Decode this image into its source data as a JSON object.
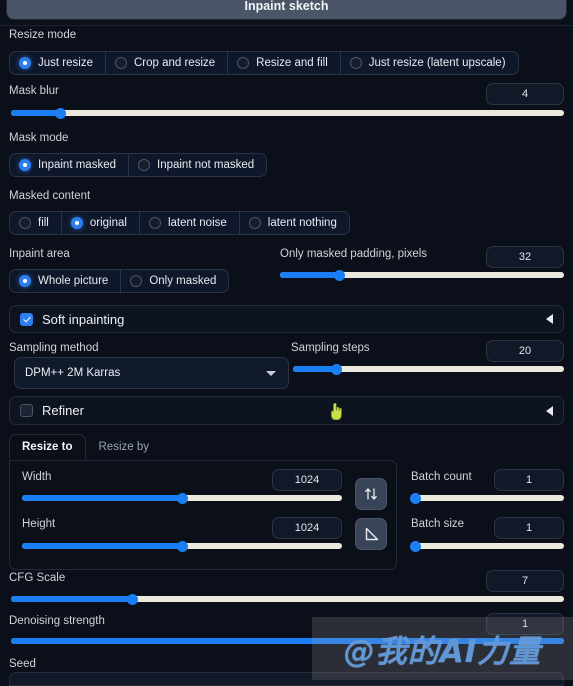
{
  "app": {
    "name": "stable-diffusion-webui-img2img-inpaint",
    "accent_color": "#2f7ef0",
    "slider_track_color": "#eceadf",
    "background_color": "#0b0f19"
  },
  "top_tab": {
    "label": "Inpaint sketch"
  },
  "resize_mode": {
    "label": "Resize mode",
    "options": [
      {
        "label": "Just resize",
        "selected": true
      },
      {
        "label": "Crop and resize",
        "selected": false
      },
      {
        "label": "Resize and fill",
        "selected": false
      },
      {
        "label": "Just resize (latent upscale)",
        "selected": false
      }
    ]
  },
  "mask_blur": {
    "label": "Mask blur",
    "value": "4",
    "percent": 9
  },
  "mask_mode": {
    "label": "Mask mode",
    "options": [
      {
        "label": "Inpaint masked",
        "selected": true
      },
      {
        "label": "Inpaint not masked",
        "selected": false
      }
    ]
  },
  "masked_content": {
    "label": "Masked content",
    "options": [
      {
        "label": "fill",
        "selected": false
      },
      {
        "label": "original",
        "selected": true
      },
      {
        "label": "latent noise",
        "selected": false
      },
      {
        "label": "latent nothing",
        "selected": false
      }
    ]
  },
  "inpaint_area": {
    "label": "Inpaint area",
    "options": [
      {
        "label": "Whole picture",
        "selected": true
      },
      {
        "label": "Only masked",
        "selected": false
      }
    ]
  },
  "only_masked_padding": {
    "label": "Only masked padding, pixels",
    "value": "32",
    "percent": 21
  },
  "soft_inpainting": {
    "label": "Soft inpainting",
    "checked": true,
    "expanded": false
  },
  "sampling_method": {
    "label": "Sampling method",
    "value": "DPM++ 2M Karras"
  },
  "sampling_steps": {
    "label": "Sampling steps",
    "value": "20",
    "percent": 16
  },
  "refiner": {
    "label": "Refiner",
    "checked": false,
    "expanded": false
  },
  "resize_panel": {
    "tabs": [
      {
        "label": "Resize to",
        "active": true
      },
      {
        "label": "Resize by",
        "active": false
      }
    ],
    "width": {
      "label": "Width",
      "value": "1024",
      "percent": 50
    },
    "height": {
      "label": "Height",
      "value": "1024",
      "percent": 50
    },
    "swap_icon": "swap-dimensions-icon",
    "ratio_icon": "aspect-ratio-icon"
  },
  "batch_count": {
    "label": "Batch count",
    "value": "1",
    "percent": 0
  },
  "batch_size": {
    "label": "Batch size",
    "value": "1",
    "percent": 0
  },
  "cfg_scale": {
    "label": "CFG Scale",
    "value": "7",
    "percent": 22
  },
  "denoising_strength": {
    "label": "Denoising strength",
    "value": "1",
    "percent": 100
  },
  "seed": {
    "label": "Seed"
  },
  "watermark": {
    "text": "@我的AI力量"
  },
  "cursor": {
    "icon": "pointing-hand-cursor"
  }
}
